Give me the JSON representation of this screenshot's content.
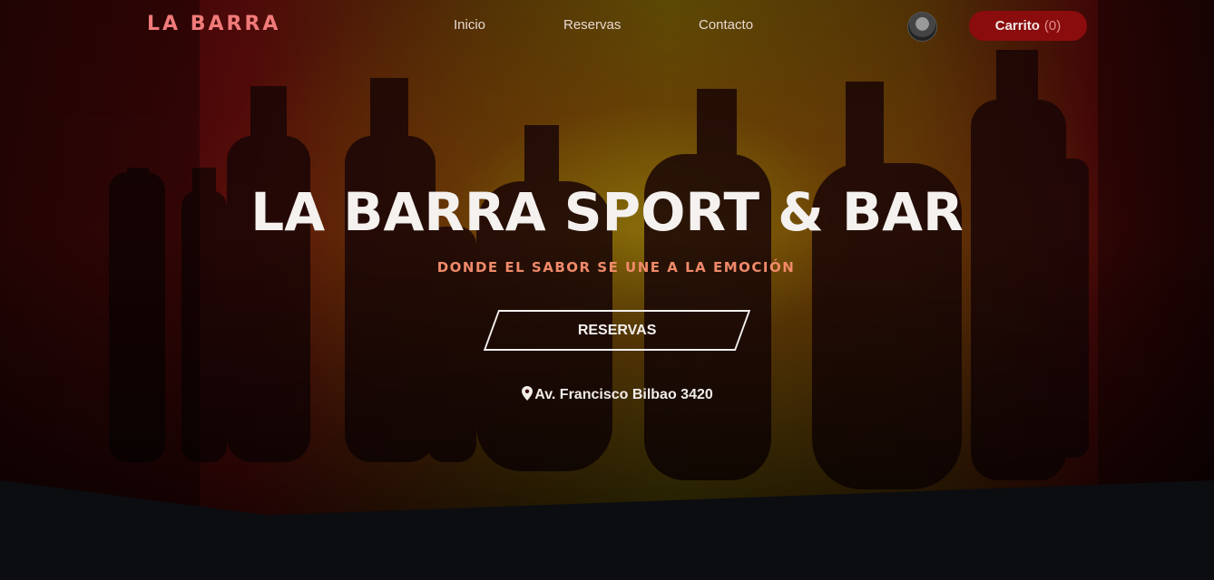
{
  "brand": {
    "logo": "LA BARRA"
  },
  "nav": {
    "links": [
      "Inicio",
      "Reservas",
      "Contacto"
    ],
    "cart_label": "Carrito",
    "cart_count": "(0)"
  },
  "hero": {
    "title": "LA BARRA SPORT & BAR",
    "subtitle": "DONDE EL SABOR SE UNE A LA EMOCIÓN",
    "cta_label": "RESERVAS",
    "address": "Av. Francisco Bilbao 3420"
  },
  "colors": {
    "accent": "#f07a7a",
    "cart_bg": "#8b0c0c",
    "subtitle": "#f08a6a",
    "text": "#f4f1ef"
  },
  "icons": {
    "address": "map-pin-icon",
    "user": "avatar"
  }
}
